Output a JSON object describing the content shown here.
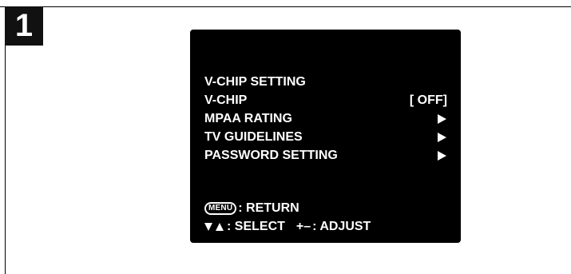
{
  "step": {
    "number": "1"
  },
  "tv": {
    "menu_title": "V-CHIP SETTING",
    "items": [
      {
        "label": "V-CHIP",
        "value": "[ OFF]",
        "icon": ""
      },
      {
        "label": "MPAA RATING",
        "value": "",
        "icon": "right-triangle-icon"
      },
      {
        "label": "TV GUIDELINES",
        "value": "",
        "icon": "right-triangle-icon"
      },
      {
        "label": "PASSWORD SETTING",
        "value": "",
        "icon": "right-triangle-icon"
      }
    ],
    "footer": {
      "menu_key": "MENU",
      "return_text": ": RETURN",
      "select_text": ": SELECT",
      "adjust_symbol": "+–",
      "adjust_text": ": ADJUST"
    }
  },
  "colors": {
    "screen_bg": "#000000",
    "text": "#ffffff",
    "badge_bg": "#111111"
  }
}
